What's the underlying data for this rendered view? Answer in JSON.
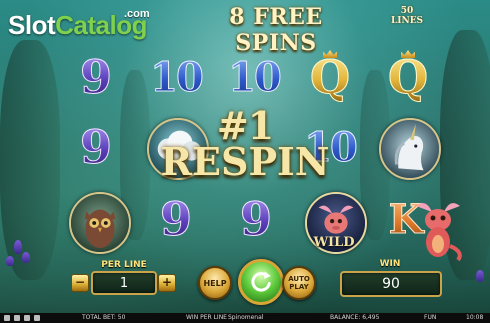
{
  "header": {
    "logo_slot": "Slot",
    "logo_catalog": "Catalog",
    "logo_com": ".com",
    "free_spins": "8 FREE SPINS",
    "lines_number": "50",
    "lines_label": "LINES"
  },
  "reels": {
    "row1": [
      "9",
      "10",
      "10",
      "Q",
      "Q"
    ],
    "row2": [
      "9",
      "10"
    ],
    "row3": [
      "9",
      "9",
      "K"
    ],
    "wild_label": "WILD"
  },
  "respin": {
    "line1": "#1",
    "line2": "RESPIN"
  },
  "controls": {
    "per_line_label": "PER LINE",
    "per_line_value": "1",
    "minus_label": "−",
    "plus_label": "+",
    "help_label": "HELP",
    "auto_play_label_1": "AUTO",
    "auto_play_label_2": "PLAY",
    "win_label": "WIN",
    "win_value": "90"
  },
  "bottom_bar": {
    "total_bet": "TOTAL BET: 50",
    "win_per_line": "WIN PER LINE",
    "brand": "Spinomenal",
    "balance": "BALANCE: 6,495",
    "mode": "FUN",
    "time": "10:08"
  },
  "colors": {
    "accent_gold": "#d9a636",
    "spin_green": "#5cc83a",
    "logo_green": "#7fd04c"
  }
}
